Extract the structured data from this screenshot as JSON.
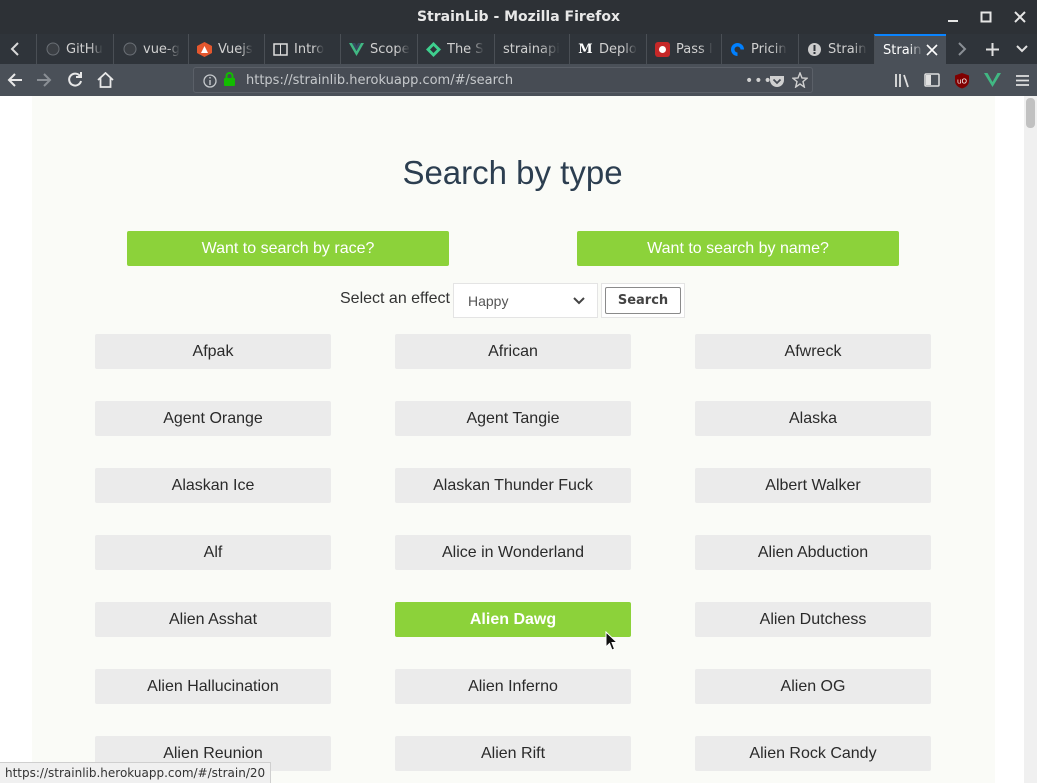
{
  "window": {
    "title": "StrainLib - Mozilla Firefox"
  },
  "tabs": [
    {
      "label": "GitHu",
      "icon": "github-icon"
    },
    {
      "label": "vue-g",
      "icon": "github-icon"
    },
    {
      "label": "Vuejs",
      "icon": "vuejs-icon"
    },
    {
      "label": "Intro",
      "icon": "book-icon"
    },
    {
      "label": "Scope",
      "icon": "vue-logo-icon"
    },
    {
      "label": "The S",
      "icon": "diamond-icon"
    },
    {
      "label": "strainapi",
      "icon": ""
    },
    {
      "label": "Deplo",
      "icon": "medium-icon"
    },
    {
      "label": "Pass I",
      "icon": "pass-icon"
    },
    {
      "label": "Pricin",
      "icon": "digitalocean-icon"
    },
    {
      "label": "Strain",
      "icon": "alert-icon"
    },
    {
      "label": "Strain",
      "icon": ""
    }
  ],
  "navbar": {
    "url": "https://strainlib.herokuapp.com/#/search"
  },
  "page": {
    "heading": "Search by type",
    "race_button": "Want to search by race?",
    "name_button": "Want to search by name?",
    "effect_label": "Select an effect",
    "effect_selected": "Happy",
    "search_button": "Search"
  },
  "strains": [
    "Afpak",
    "African",
    "Afwreck",
    "Agent Orange",
    "Agent Tangie",
    "Alaska",
    "Alaskan Ice",
    "Alaskan Thunder Fuck",
    "Albert Walker",
    "Alf",
    "Alice in Wonderland",
    "Alien Abduction",
    "Alien Asshat",
    "Alien Dawg",
    "Alien Dutchess",
    "Alien Hallucination",
    "Alien Inferno",
    "Alien OG",
    "Alien Reunion",
    "Alien Rift",
    "Alien Rock Candy"
  ],
  "highlighted_strain": "Alien Dawg",
  "status_url": "https://strainlib.herokuapp.com/#/strain/20",
  "colors": {
    "accent_green": "#8cd23a",
    "heading": "#2c3e50",
    "tab_highlight": "#0a84ff"
  }
}
